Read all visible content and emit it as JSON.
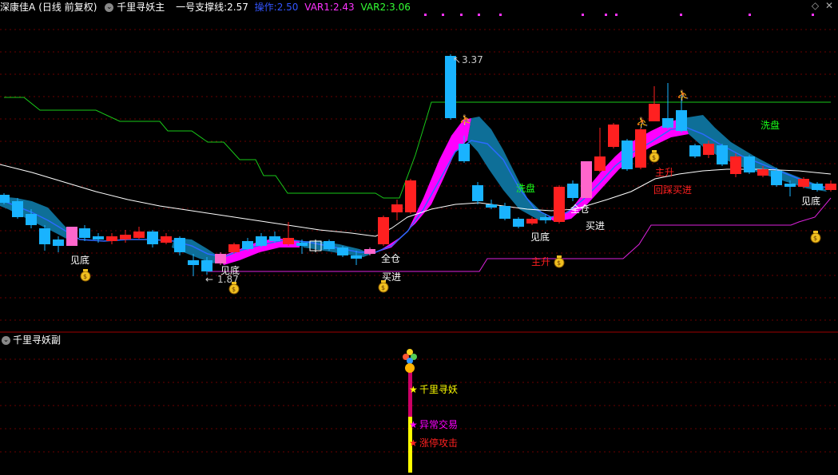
{
  "header": {
    "stock": "深康佳A",
    "period": "(日线 前复权)",
    "indicator": "千里寻妖主",
    "support": {
      "label": "一号支撑线:",
      "value": "2.57"
    },
    "op": {
      "label": "操作:",
      "value": "2.50"
    },
    "var1": {
      "label": "VAR1:",
      "value": "2.43"
    },
    "var2": {
      "label": "VAR2:",
      "value": "3.06"
    }
  },
  "sub_header": {
    "indicator": "千里寻妖副"
  },
  "colors": {
    "up": "#ff2020",
    "down": "#19b3ff",
    "pink": "#ff66cc",
    "magenta": "#ff00ff",
    "teal": "#0e6f98",
    "green_line": "#19c819",
    "grid": "#7a0000",
    "white_line": "#ffffff",
    "yellow": "#ffff00"
  },
  "chart_data": {
    "type": "candlestick",
    "high_label": "3.37",
    "low_label": "1.87",
    "annotations": [
      {
        "text": "见底",
        "color": "#ffffff"
      },
      {
        "text": "见底",
        "color": "#ffffff"
      },
      {
        "text": "全仓",
        "color": "#ffffff"
      },
      {
        "text": "买进",
        "color": "#ffffff"
      },
      {
        "text": "洗盘",
        "color": "#19ff19"
      },
      {
        "text": "见底",
        "color": "#ffffff"
      },
      {
        "text": "全仓",
        "color": "#ffffff"
      },
      {
        "text": "买进",
        "color": "#ffffff"
      },
      {
        "text": "主升",
        "color": "#ff2020"
      },
      {
        "text": "主升",
        "color": "#ff2020"
      },
      {
        "text": "回踩买进",
        "color": "#ff2020"
      },
      {
        "text": "洗盘",
        "color": "#19ff19"
      },
      {
        "text": "见底",
        "color": "#ffffff"
      }
    ],
    "sub_labels": [
      {
        "text": "千里寻妖",
        "color": "#ffff00"
      },
      {
        "text": "异常交易",
        "color": "#ff00ff"
      },
      {
        "text": "涨停攻击",
        "color": "#ff2020"
      }
    ]
  }
}
